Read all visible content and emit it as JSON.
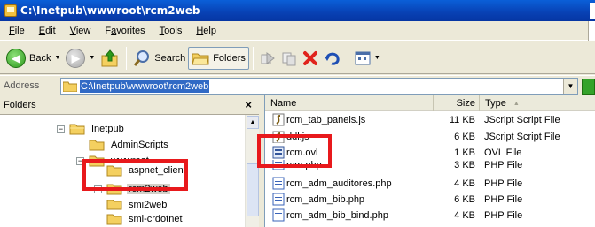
{
  "window": {
    "title": "C:\\Inetpub\\wwwroot\\rcm2web"
  },
  "menu": [
    {
      "label": "File",
      "ul": "F"
    },
    {
      "label": "Edit",
      "ul": "E"
    },
    {
      "label": "View",
      "ul": "V"
    },
    {
      "label": "Favorites",
      "ul": "a"
    },
    {
      "label": "Tools",
      "ul": "T"
    },
    {
      "label": "Help",
      "ul": "H"
    }
  ],
  "toolbar": {
    "back_label": "Back",
    "search_label": "Search",
    "folders_label": "Folders"
  },
  "address": {
    "label": "Address",
    "value": "C:\\Inetpub\\wwwroot\\rcm2web"
  },
  "folders_pane": {
    "title": "Folders",
    "close_glyph": "×",
    "tree": [
      {
        "label": "Inetpub",
        "expander": "−"
      },
      {
        "label": "AdminScripts",
        "expander": ""
      },
      {
        "label": "wwwroot",
        "expander": "−"
      },
      {
        "label": "aspnet_client",
        "expander": ""
      },
      {
        "label": "rcm2web",
        "expander": "+"
      },
      {
        "label": "smi2web",
        "expander": ""
      },
      {
        "label": "smi-crdotnet",
        "expander": ""
      }
    ]
  },
  "files_pane": {
    "columns": {
      "name": "Name",
      "size": "Size",
      "type": "Type"
    },
    "files": [
      {
        "name": "rcm_tab_panels.js",
        "size": "11 KB",
        "type": "JScript Script File",
        "icon": "script-icon"
      },
      {
        "name": "ddl.js",
        "size": "6 KB",
        "type": "JScript Script File",
        "icon": "script-icon"
      },
      {
        "name": "rcm.ovl",
        "size": "1 KB",
        "type": "OVL File",
        "icon": "ovl-file-icon"
      },
      {
        "name": "rcm.php",
        "size": "3 KB",
        "type": "PHP File",
        "icon": "php-file-icon"
      },
      {
        "name": "rcm_adm_auditores.php",
        "size": "4 KB",
        "type": "PHP File",
        "icon": "php-file-icon"
      },
      {
        "name": "rcm_adm_bib.php",
        "size": "6 KB",
        "type": "PHP File",
        "icon": "php-file-icon"
      },
      {
        "name": "rcm_adm_bib_bind.php",
        "size": "4 KB",
        "type": "PHP File",
        "icon": "php-file-icon"
      }
    ]
  },
  "colors": {
    "highlight_box": "#e8191c",
    "title_bar": "#0841b4",
    "selection": "#316ac5"
  }
}
